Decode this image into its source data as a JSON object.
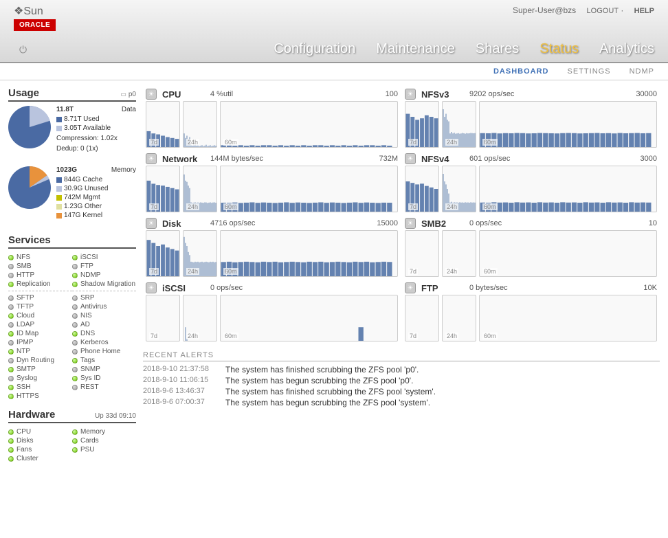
{
  "header": {
    "brand": "Sun",
    "oracle": "ORACLE",
    "user": "Super-User@bzs",
    "logout": "LOGOUT",
    "help": "HELP",
    "nav": [
      "Configuration",
      "Maintenance",
      "Shares",
      "Status",
      "Analytics"
    ],
    "active_nav": "Status",
    "subnav": [
      "DASHBOARD",
      "SETTINGS",
      "NDMP"
    ],
    "active_subnav": "DASHBOARD"
  },
  "usage": {
    "title": "Usage",
    "pool_label": "p0",
    "data": {
      "total": "11.8T",
      "label": "Data",
      "used": "8.71T Used",
      "avail": "3.05T Available",
      "used_color": "#4a6aa3",
      "avail_color": "#b9c4de",
      "compression": "Compression: 1.02x",
      "dedup": "Dedup: 0 (1x)"
    },
    "memory": {
      "total": "1023G",
      "label": "Memory",
      "items": [
        {
          "label": "844G Cache",
          "color": "#4a6aa3"
        },
        {
          "label": "30.9G Unused",
          "color": "#b9c4de"
        },
        {
          "label": "742M Mgmt",
          "color": "#c2c000"
        },
        {
          "label": "1.23G Other",
          "color": "#e0e0a0"
        },
        {
          "label": "147G Kernel",
          "color": "#e8923c"
        }
      ]
    }
  },
  "services": {
    "title": "Services",
    "col1_a": [
      {
        "name": "NFS",
        "on": true
      },
      {
        "name": "SMB",
        "on": false
      },
      {
        "name": "HTTP",
        "on": false
      },
      {
        "name": "Replication",
        "on": true
      }
    ],
    "col1_b": [
      {
        "name": "SFTP",
        "on": false
      },
      {
        "name": "TFTP",
        "on": false
      },
      {
        "name": "Cloud",
        "on": true
      },
      {
        "name": "LDAP",
        "on": false
      },
      {
        "name": "ID Map",
        "on": true
      },
      {
        "name": "IPMP",
        "on": false
      },
      {
        "name": "NTP",
        "on": true
      },
      {
        "name": "Dyn Routing",
        "on": false
      },
      {
        "name": "SMTP",
        "on": true
      },
      {
        "name": "Syslog",
        "on": false
      },
      {
        "name": "SSH",
        "on": true
      },
      {
        "name": "HTTPS",
        "on": true
      }
    ],
    "col2_a": [
      {
        "name": "iSCSI",
        "on": true
      },
      {
        "name": "FTP",
        "on": false
      },
      {
        "name": "NDMP",
        "on": true
      },
      {
        "name": "Shadow Migration",
        "on": true
      }
    ],
    "col2_b": [
      {
        "name": "SRP",
        "on": false
      },
      {
        "name": "Antivirus",
        "on": false
      },
      {
        "name": "NIS",
        "on": false
      },
      {
        "name": "AD",
        "on": false
      },
      {
        "name": "DNS",
        "on": true
      },
      {
        "name": "Kerberos",
        "on": false
      },
      {
        "name": "Phone Home",
        "on": false
      },
      {
        "name": "Tags",
        "on": true
      },
      {
        "name": "SNMP",
        "on": false
      },
      {
        "name": "Sys ID",
        "on": true
      },
      {
        "name": "REST",
        "on": false
      }
    ]
  },
  "hardware": {
    "title": "Hardware",
    "uptime": "Up 33d 09:10",
    "col1": [
      {
        "name": "CPU",
        "on": true
      },
      {
        "name": "Disks",
        "on": true
      },
      {
        "name": "Fans",
        "on": true
      },
      {
        "name": "Cluster",
        "on": true
      }
    ],
    "col2": [
      {
        "name": "Memory",
        "on": true
      },
      {
        "name": "Cards",
        "on": true
      },
      {
        "name": "PSU",
        "on": true
      }
    ]
  },
  "graphs": [
    {
      "title": "CPU",
      "stat": "4 %util",
      "max": "100"
    },
    {
      "title": "NFSv3",
      "stat": "9202 ops/sec",
      "max": "30000"
    },
    {
      "title": "Network",
      "stat": "144M bytes/sec",
      "max": "732M"
    },
    {
      "title": "NFSv4",
      "stat": "601 ops/sec",
      "max": "3000"
    },
    {
      "title": "Disk",
      "stat": "4716 ops/sec",
      "max": "15000"
    },
    {
      "title": "SMB2",
      "stat": "0 ops/sec",
      "max": "10"
    },
    {
      "title": "iSCSI",
      "stat": "0 ops/sec",
      "max": ""
    },
    {
      "title": "FTP",
      "stat": "0 bytes/sec",
      "max": "10K"
    }
  ],
  "graph_labels": {
    "l7d": "7d",
    "l24h": "24h",
    "l60m": "60m"
  },
  "alerts": {
    "title": "RECENT ALERTS",
    "rows": [
      {
        "t": "2018-9-10 21:37:58",
        "m": "The system has finished scrubbing the ZFS pool 'p0'."
      },
      {
        "t": "2018-9-10 11:06:15",
        "m": "The system has begun scrubbing the ZFS pool 'p0'."
      },
      {
        "t": "2018-9-6 13:46:37",
        "m": "The system has finished scrubbing the ZFS pool 'system'."
      },
      {
        "t": "2018-9-6 07:00:37",
        "m": "The system has begun scrubbing the ZFS pool 'system'."
      }
    ]
  },
  "chart_data": {
    "data_pie": {
      "type": "pie",
      "series": [
        {
          "name": "Used",
          "value": 8.71,
          "color": "#4a6aa3"
        },
        {
          "name": "Available",
          "value": 3.05,
          "color": "#b9c4de"
        }
      ],
      "unit": "T",
      "total": "11.8T"
    },
    "memory_pie": {
      "type": "pie",
      "series": [
        {
          "name": "Cache",
          "value": 844,
          "color": "#4a6aa3"
        },
        {
          "name": "Unused",
          "value": 30.9,
          "color": "#b9c4de"
        },
        {
          "name": "Mgmt",
          "value": 0.742,
          "color": "#c2c000"
        },
        {
          "name": "Other",
          "value": 1.23,
          "color": "#e0e0a0"
        },
        {
          "name": "Kernel",
          "value": 147,
          "color": "#e8923c"
        }
      ],
      "unit": "G",
      "total": "1023G"
    },
    "sparklines": {
      "CPU": {
        "ylim": [
          0,
          100
        ],
        "unit": "%util",
        "series_7d": [
          35,
          30,
          28,
          25,
          22,
          20,
          18
        ],
        "series_24h": [
          30,
          20,
          25,
          18,
          22,
          5,
          3,
          4,
          5,
          3,
          4,
          2,
          3,
          4,
          2,
          3,
          5,
          2,
          3,
          4,
          2,
          3,
          4,
          3
        ],
        "series_60m": [
          4,
          4,
          3,
          4,
          3,
          4,
          3,
          4,
          4,
          3,
          4,
          3,
          4,
          3,
          4,
          3,
          4,
          4,
          3,
          4,
          3,
          4,
          3,
          4,
          3,
          4,
          4,
          3,
          4,
          3
        ]
      },
      "NFSv3": {
        "ylim": [
          0,
          30000
        ],
        "unit": "ops/sec",
        "series_7d": [
          22000,
          20000,
          18000,
          19000,
          21000,
          20000,
          19000
        ],
        "series_24h": [
          25000,
          20000,
          22000,
          18000,
          17000,
          9000,
          10000,
          9000,
          9500,
          8800,
          9000,
          9200,
          8800,
          9000,
          9300,
          9100,
          8800,
          9200,
          9000,
          9100,
          9300,
          9200,
          9100,
          9200
        ],
        "series_60m": [
          9200,
          9100,
          9300,
          9000,
          9200,
          9100,
          9300,
          9200,
          9000,
          9100,
          9300,
          9200,
          9100,
          9000,
          9200,
          9300,
          9200,
          9000,
          9100,
          9200,
          9300,
          9100,
          9200,
          9000,
          9300,
          9100,
          9200,
          9300,
          9100,
          9202
        ]
      },
      "Network": {
        "ylim": [
          0,
          732
        ],
        "unit": "M bytes/sec",
        "series_7d": [
          500,
          450,
          430,
          420,
          400,
          380,
          360
        ],
        "series_24h": [
          600,
          500,
          480,
          420,
          380,
          150,
          140,
          145,
          150,
          140,
          148,
          142,
          150,
          145,
          142,
          150,
          148,
          140,
          145,
          150,
          142,
          148,
          150,
          144
        ],
        "series_60m": [
          144,
          142,
          148,
          140,
          145,
          150,
          142,
          148,
          144,
          140,
          145,
          150,
          142,
          148,
          144,
          140,
          145,
          150,
          142,
          148,
          144,
          140,
          145,
          150,
          142,
          148,
          144,
          140,
          145,
          144
        ]
      },
      "NFSv4": {
        "ylim": [
          0,
          3000
        ],
        "unit": "ops/sec",
        "series_7d": [
          2000,
          1900,
          1800,
          1850,
          1700,
          1600,
          1500
        ],
        "series_24h": [
          2500,
          2000,
          1800,
          1500,
          1200,
          600,
          650,
          580,
          620,
          600,
          610,
          590,
          620,
          600,
          610,
          590,
          620,
          600,
          610,
          590,
          620,
          600,
          610,
          601
        ],
        "series_60m": [
          601,
          590,
          620,
          600,
          610,
          590,
          620,
          600,
          610,
          590,
          620,
          600,
          610,
          590,
          620,
          600,
          610,
          590,
          620,
          600,
          610,
          590,
          620,
          600,
          610,
          590,
          620,
          600,
          610,
          601
        ]
      },
      "Disk": {
        "ylim": [
          0,
          15000
        ],
        "unit": "ops/sec",
        "series_7d": [
          12000,
          11000,
          10000,
          10500,
          9500,
          9000,
          8500
        ],
        "series_24h": [
          13000,
          11000,
          10000,
          8000,
          7000,
          4800,
          4700,
          4600,
          4800,
          4700,
          4800,
          4600,
          4700,
          4800,
          4600,
          4700,
          4800,
          4700,
          4600,
          4800,
          4700,
          4800,
          4600,
          4716
        ],
        "series_60m": [
          4700,
          4800,
          4600,
          4700,
          4800,
          4700,
          4600,
          4800,
          4700,
          4800,
          4600,
          4700,
          4800,
          4700,
          4600,
          4800,
          4700,
          4800,
          4600,
          4700,
          4800,
          4700,
          4600,
          4800,
          4700,
          4800,
          4600,
          4700,
          4800,
          4716
        ]
      },
      "SMB2": {
        "ylim": [
          0,
          10
        ],
        "unit": "ops/sec",
        "series_7d": [
          0,
          0,
          0,
          0,
          0,
          0,
          0
        ],
        "series_24h": [
          0,
          0,
          0,
          0,
          0,
          0,
          0,
          0,
          0,
          0,
          0,
          0,
          0,
          0,
          0,
          0,
          0,
          0,
          0,
          0,
          0,
          0,
          0,
          0
        ],
        "series_60m": [
          0,
          0,
          0,
          0,
          0,
          0,
          0,
          0,
          0,
          0,
          0,
          0,
          0,
          0,
          0,
          0,
          0,
          0,
          0,
          0,
          0,
          0,
          0,
          0,
          0,
          0,
          0,
          0,
          0,
          0
        ]
      },
      "iSCSI": {
        "ylim": [
          0,
          100
        ],
        "unit": "ops/sec",
        "series_7d": [
          0,
          0,
          0,
          0,
          0,
          0,
          0
        ],
        "series_24h": [
          0,
          30,
          5,
          0,
          0,
          0,
          0,
          0,
          0,
          0,
          0,
          0,
          0,
          0,
          0,
          0,
          0,
          0,
          0,
          0,
          0,
          0,
          0,
          0
        ],
        "series_60m": [
          0,
          0,
          0,
          0,
          0,
          0,
          0,
          0,
          0,
          0,
          0,
          0,
          0,
          0,
          0,
          0,
          0,
          0,
          0,
          0,
          0,
          0,
          0,
          0,
          30,
          0,
          0,
          0,
          0,
          0
        ]
      },
      "FTP": {
        "ylim": [
          0,
          10000
        ],
        "unit": "bytes/sec",
        "series_7d": [
          0,
          0,
          0,
          0,
          0,
          0,
          0
        ],
        "series_24h": [
          0,
          0,
          0,
          0,
          0,
          0,
          0,
          0,
          0,
          0,
          0,
          0,
          0,
          0,
          0,
          0,
          0,
          0,
          0,
          0,
          0,
          0,
          0,
          0
        ],
        "series_60m": [
          0,
          0,
          0,
          0,
          0,
          0,
          0,
          0,
          0,
          0,
          0,
          0,
          0,
          0,
          0,
          0,
          0,
          0,
          0,
          0,
          0,
          0,
          0,
          0,
          0,
          0,
          0,
          0,
          0,
          0
        ]
      }
    }
  }
}
